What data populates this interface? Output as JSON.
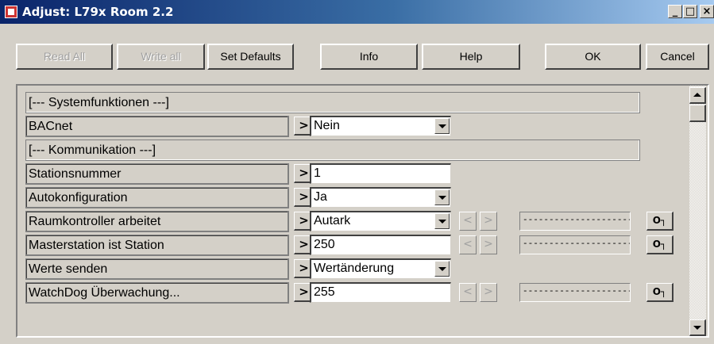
{
  "window": {
    "title": "Adjust: L79x Room 2.2",
    "controls": {
      "minimize": "_",
      "maximize": "□",
      "close": "×"
    }
  },
  "toolbar": {
    "read_all": "Read All",
    "write_all": "Write all",
    "set_defaults": "Set Defaults",
    "info": "Info",
    "help": "Help",
    "ok": "OK",
    "cancel": "Cancel"
  },
  "rows": {
    "r0": {
      "header": "[--- Systemfunktionen ---]"
    },
    "r1": {
      "label": "BACnet",
      "value": "Nein",
      "arrow": ">"
    },
    "r2": {
      "header": "[--- Kommunikation ---]"
    },
    "r3": {
      "label": "Stationsnummer",
      "value": "1",
      "arrow": ">"
    },
    "r4": {
      "label": "Autokonfiguration",
      "value": "Ja",
      "arrow": ">"
    },
    "r5": {
      "label": "Raumkontroller arbeitet",
      "value": "Autark",
      "arrow": ">",
      "prev": "<",
      "next": ">",
      "dashes": "----------------------------",
      "key": "O┐"
    },
    "r6": {
      "label": "Masterstation ist Station",
      "value": "250",
      "arrow": ">",
      "prev": "<",
      "next": ">",
      "dashes": "----------------------------",
      "key": "O┐"
    },
    "r7": {
      "label": "Werte senden",
      "value": "Wertänderung",
      "arrow": ">"
    },
    "r8": {
      "label": "WatchDog Überwachung...",
      "value": "255",
      "arrow": ">",
      "prev": "<",
      "next": ">",
      "dashes": "----------------------------",
      "key": "O┐"
    }
  },
  "icons": {
    "app": "app-icon",
    "dropdown": "chevron-down-icon",
    "key": "key-icon",
    "scroll_up": "arrow-up-icon",
    "scroll_down": "arrow-down-icon"
  }
}
